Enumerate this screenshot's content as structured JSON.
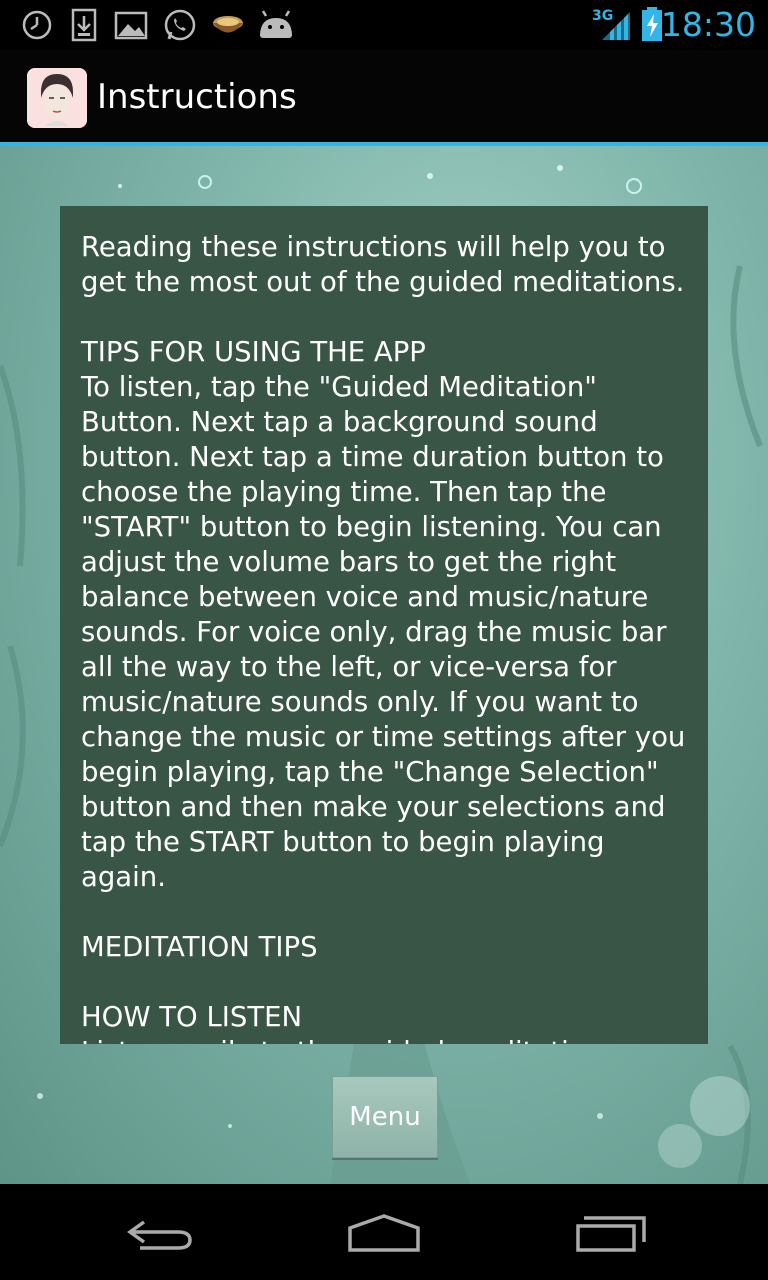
{
  "status_bar": {
    "time": "18:30",
    "network_label": "3G",
    "icons": [
      "clock-icon",
      "download-icon",
      "image-icon",
      "whatsapp-icon",
      "bowl-icon",
      "android-icon",
      "signal-icon",
      "battery-charging-icon"
    ],
    "accent_color": "#33b5e5"
  },
  "action_bar": {
    "title": "Instructions",
    "app_icon": "face-icon"
  },
  "instructions": {
    "text": "Reading these instructions will help you to get the most out of the guided meditations.\n\nTIPS FOR USING THE APP\nTo listen, tap the \"Guided Meditation\" Button. Next tap a background sound button. Next tap a time duration button to choose the playing time. Then tap the \"START\" button to begin listening. You can adjust the volume bars to get the right balance between voice and music/nature sounds. For voice only, drag the music bar all the way to the left, or vice-versa for music/nature sounds only. If you want to change the music or time settings after you begin playing, tap the \"Change Selection\" button and then make your selections and tap the START button to begin playing again.\n\nMEDITATION TIPS\n\nHOW TO LISTEN\nListen easily to the guided meditations,"
  },
  "menu_button": {
    "label": "Menu"
  },
  "nav_bar": {
    "buttons": [
      "back-icon",
      "home-icon",
      "recents-icon"
    ]
  }
}
